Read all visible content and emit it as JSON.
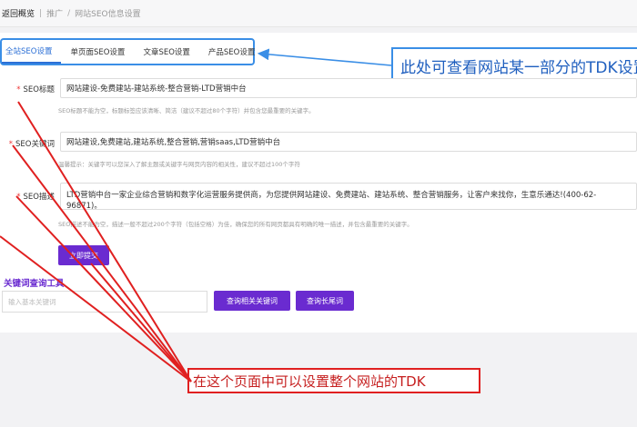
{
  "breadcrumb": {
    "back": "返回概览",
    "level1": "推广",
    "current": "网站SEO信息设置"
  },
  "tabs": [
    {
      "label": "全站SEO设置",
      "active": true
    },
    {
      "label": "单页面SEO设置",
      "active": false
    },
    {
      "label": "文章SEO设置",
      "active": false
    },
    {
      "label": "产品SEO设置",
      "active": false
    }
  ],
  "callout_blue": "此处可查看网站某一部分的TDK设置",
  "seo_title": {
    "label": "SEO标题",
    "value": "网站建设-免费建站-建站系统-整合营销-LTD营销中台",
    "hint": "SEO标题不能为空，标题标签应该清晰、简洁（建议不超过80个字符）并包含您最重要的关键字。"
  },
  "seo_keywords": {
    "label": "SEO关键词",
    "value": "网站建设,免费建站,建站系统,整合营销,营销saas,LTD营销中台",
    "hint": "温馨提示：关键字可以您深入了解主题或关键字与网页内容的相关性，建议不超过100个字符"
  },
  "seo_desc": {
    "label": "SEO描述",
    "value": "LTD营销中台一家企业综合营销和数字化运营服务提供商，为您提供网站建设、免费建站、建站系统、整合营销服务，让客户来找你，生意乐通达!(400-62-96871)。",
    "hint": "SEO描述不能为空，描述一般不超过200个字符（包括空格）为佳，确保您的所有网页都具有明确的唯一描述，并包含最重要的关键字。"
  },
  "submit_label": "立即提交",
  "keyword_tool": {
    "title": "关键词查询工具",
    "placeholder": "输入基本关键词",
    "btn_related": "查询相关关键词",
    "btn_longtail": "查询长尾词"
  },
  "note_red": "在这个页面中可以设置整个网站的TDK",
  "colors": {
    "accent": "#6a2bd0",
    "callout_blue": "#3a8ee6",
    "note_red": "#e02020"
  }
}
